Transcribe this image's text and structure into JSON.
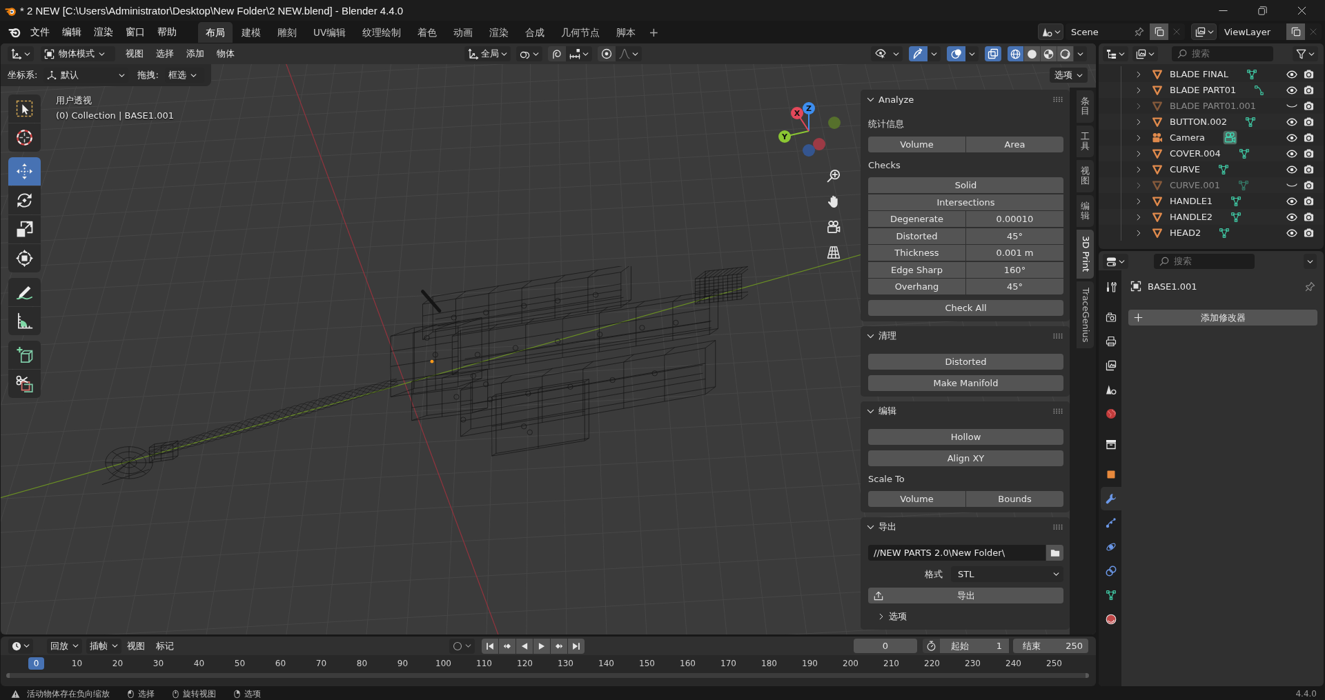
{
  "window": {
    "title": "* 2 NEW [C:\\Users\\Administrator\\Desktop\\New Folder\\2 NEW.blend] - Blender 4.4.0"
  },
  "top_bar": {
    "menus": [
      "文件",
      "编辑",
      "渲染",
      "窗口",
      "帮助"
    ],
    "workspace_tabs": [
      {
        "label": "布局",
        "selected": true
      },
      {
        "label": "建模",
        "selected": false
      },
      {
        "label": "雕刻",
        "selected": false
      },
      {
        "label": "UV编辑",
        "selected": false
      },
      {
        "label": "纹理绘制",
        "selected": false
      },
      {
        "label": "着色",
        "selected": false
      },
      {
        "label": "动画",
        "selected": false
      },
      {
        "label": "渲染",
        "selected": false
      },
      {
        "label": "合成",
        "selected": false
      },
      {
        "label": "几何节点",
        "selected": false
      },
      {
        "label": "脚本",
        "selected": false
      }
    ],
    "add_tab": "+",
    "scene": "Scene",
    "view_layer": "ViewLayer"
  },
  "viewport": {
    "header": {
      "mode": "物体模式",
      "menus": [
        "视图",
        "选择",
        "添加",
        "物体"
      ],
      "orientation": "全局",
      "toggles": [
        {
          "kind": "visibility",
          "on": false
        },
        {
          "kind": "gizmo",
          "on": true
        },
        {
          "kind": "overlay",
          "on": true
        },
        {
          "kind": "xray",
          "on": true
        }
      ],
      "shading": [
        {
          "kind": "wireframe",
          "selected": true
        },
        {
          "kind": "solid",
          "selected": false
        },
        {
          "kind": "material",
          "selected": false
        },
        {
          "kind": "rendered",
          "selected": false
        }
      ]
    },
    "tool_settings": {
      "coordinate_label": "坐标系:",
      "coordinate_value": "默认",
      "drag_label": "拖拽:",
      "drag_value": "框选",
      "options": "选项"
    },
    "tool_groups": [
      [
        {
          "kind": "select_box",
          "selected": false
        },
        {
          "kind": "cursor",
          "selected": false
        }
      ],
      [
        {
          "kind": "move",
          "selected": true
        },
        {
          "kind": "rotate",
          "selected": false
        },
        {
          "kind": "scale",
          "selected": false
        },
        {
          "kind": "transform",
          "selected": false
        }
      ],
      [
        {
          "kind": "annotate",
          "selected": false
        },
        {
          "kind": "measure",
          "selected": false
        }
      ],
      [
        {
          "kind": "add_cube",
          "selected": false
        },
        {
          "kind": "cut",
          "selected": false
        }
      ]
    ],
    "view_name": "用户透视",
    "context": "(0) Collection | BASE1.001",
    "gizmo_axes": [
      {
        "kind": "neg_y",
        "color": "#56702c"
      },
      {
        "kind": "neg_x",
        "color": "#9c3a45"
      },
      {
        "kind": "neg_z",
        "color": "#34558f"
      },
      {
        "kind": "y",
        "label": "Y",
        "color": "#8bc633"
      },
      {
        "kind": "z",
        "label": "Z",
        "color": "#3d8ef0"
      },
      {
        "kind": "x",
        "label": "X",
        "color": "#e4485a"
      }
    ],
    "sidebar": {
      "panels": [
        {
          "title": "Analyze",
          "expanded": true,
          "rows": [
            {
              "kind": "label",
              "text": "统计信息"
            },
            {
              "kind": "pair",
              "labels": [
                "Volume",
                "Area"
              ]
            },
            {
              "kind": "label",
              "text": "Checks"
            },
            {
              "kind": "column",
              "items": [
                {
                  "label": "Solid"
                },
                {
                  "label": "Intersections"
                },
                {
                  "label": "Degenerate",
                  "value": "0.00010"
                },
                {
                  "label": "Distorted",
                  "value": "45°"
                },
                {
                  "label": "Thickness",
                  "value": "0.001 m"
                },
                {
                  "label": "Edge Sharp",
                  "value": "160°"
                },
                {
                  "label": "Overhang",
                  "value": "45°"
                }
              ]
            },
            {
              "kind": "button",
              "label": "Check All"
            }
          ]
        },
        {
          "title": "清理",
          "expanded": true,
          "rows": [
            {
              "kind": "button",
              "label": "Distorted"
            },
            {
              "kind": "button",
              "label": "Make Manifold"
            }
          ]
        },
        {
          "title": "编辑",
          "expanded": true,
          "rows": [
            {
              "kind": "button",
              "label": "Hollow"
            },
            {
              "kind": "button",
              "label": "Align XY"
            },
            {
              "kind": "label",
              "text": "Scale To"
            },
            {
              "kind": "pair",
              "labels": [
                "Volume",
                "Bounds"
              ]
            }
          ]
        },
        {
          "title": "导出",
          "expanded": true,
          "rows": [
            {
              "kind": "path",
              "value": "//NEW PARTS 2.0\\New Folder\\"
            },
            {
              "kind": "select",
              "label": "格式",
              "value": "STL"
            },
            {
              "kind": "export",
              "label": "导出"
            },
            {
              "kind": "subpanel",
              "label": "选项",
              "expanded": false
            }
          ]
        }
      ],
      "tabs": [
        {
          "label": "条目",
          "kind": "stacked",
          "selected": false
        },
        {
          "label": "工具",
          "kind": "stacked",
          "selected": false
        },
        {
          "label": "视图",
          "kind": "stacked",
          "selected": false
        },
        {
          "label": "编辑",
          "kind": "stacked",
          "selected": false
        },
        {
          "label": "3D Print",
          "kind": "rotated",
          "selected": true
        },
        {
          "label": "TraceGenius",
          "kind": "rotated",
          "selected": false
        }
      ]
    }
  },
  "outliner": {
    "search_placeholder": "搜索",
    "rows": [
      {
        "name": "BLADE FINAL",
        "kind": "mesh",
        "data": {
          "kind": "mesh"
        },
        "visible": true
      },
      {
        "name": "BLADE PART01",
        "kind": "mesh",
        "data": {
          "kind": "curve"
        },
        "visible": true
      },
      {
        "name": "BLADE PART01.001",
        "kind": "mesh",
        "visible": false
      },
      {
        "name": "BUTTON.002",
        "kind": "mesh",
        "data": {
          "kind": "mesh"
        },
        "visible": true
      },
      {
        "name": "Camera",
        "kind": "camera",
        "data": {
          "kind": "camera"
        },
        "visible": true
      },
      {
        "name": "COVER.004",
        "kind": "mesh",
        "data": {
          "kind": "mesh"
        },
        "visible": true
      },
      {
        "name": "CURVE",
        "kind": "mesh",
        "data": {
          "kind": "mesh"
        },
        "visible": true
      },
      {
        "name": "CURVE.001",
        "kind": "mesh",
        "data": {
          "kind": "mesh"
        },
        "visible": false
      },
      {
        "name": "HANDLE1",
        "kind": "mesh",
        "data": {
          "kind": "mesh"
        },
        "visible": true
      },
      {
        "name": "HANDLE2",
        "kind": "mesh",
        "data": {
          "kind": "mesh"
        },
        "visible": true
      },
      {
        "name": "HEAD2",
        "kind": "mesh",
        "data": {
          "kind": "mesh"
        },
        "visible": true
      }
    ]
  },
  "properties": {
    "search_placeholder": "搜索",
    "tab_groups": [
      [
        {
          "kind": "tool",
          "selected": false
        }
      ],
      [
        {
          "kind": "render",
          "selected": false
        },
        {
          "kind": "output",
          "selected": false
        },
        {
          "kind": "view_layer",
          "selected": false
        },
        {
          "kind": "scene",
          "selected": false
        },
        {
          "kind": "world",
          "selected": false
        }
      ],
      [
        {
          "kind": "collection",
          "selected": false
        }
      ],
      [
        {
          "kind": "object",
          "selected": false
        },
        {
          "kind": "modifiers",
          "selected": true
        },
        {
          "kind": "particles",
          "selected": false
        },
        {
          "kind": "physics",
          "selected": false
        },
        {
          "kind": "constraints",
          "selected": false
        },
        {
          "kind": "data",
          "selected": false
        },
        {
          "kind": "material",
          "selected": false
        }
      ]
    ],
    "object_name": "BASE1.001",
    "add_modifier": "添加修改器"
  },
  "timeline": {
    "menus": [
      {
        "label": "回放",
        "kind": "dropdown"
      },
      {
        "label": "插帧",
        "kind": "dropdown"
      },
      {
        "label": "视图",
        "kind": "menu"
      },
      {
        "label": "标记",
        "kind": "menu"
      }
    ],
    "current_frame": "0",
    "start_label": "起始",
    "start": "1",
    "end_label": "结束",
    "end": "250",
    "playhead": "0",
    "ruler_labels": [
      "10",
      "20",
      "30",
      "40",
      "50",
      "60",
      "70",
      "80",
      "90",
      "100",
      "110",
      "120",
      "130",
      "140",
      "150",
      "160",
      "170",
      "180",
      "190",
      "200",
      "210",
      "220",
      "230",
      "240",
      "250"
    ]
  },
  "status_bar": {
    "warning": "活动物体存在负向缩放",
    "hints": [
      {
        "kind": "left",
        "label": "选择"
      },
      {
        "kind": "middle",
        "label": "旋转视图"
      },
      {
        "kind": "right",
        "label": "选项"
      }
    ],
    "version": "4.4.0"
  }
}
